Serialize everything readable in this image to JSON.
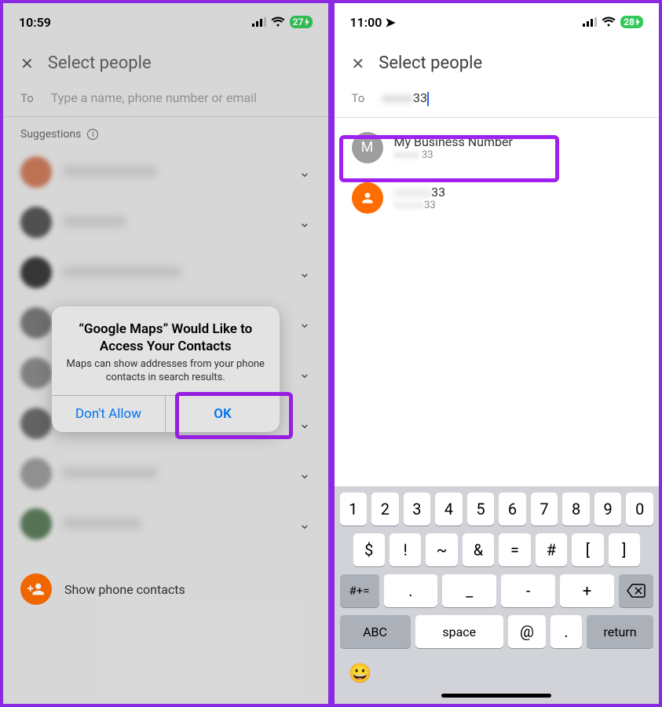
{
  "left": {
    "status": {
      "time": "10:59",
      "battery": "27"
    },
    "header": {
      "title": "Select people"
    },
    "to": {
      "label": "To",
      "placeholder": "Type a name, phone number or email"
    },
    "suggestions_label": "Suggestions",
    "dialog": {
      "title": "“Google Maps” Would Like to Access Your Contacts",
      "message": "Maps can show addresses from your phone contacts in search results.",
      "deny": "Don't Allow",
      "allow": "OK"
    },
    "show_contacts": "Show phone contacts"
  },
  "right": {
    "status": {
      "time": "11:00",
      "battery": "28"
    },
    "header": {
      "title": "Select people"
    },
    "to": {
      "label": "To",
      "value": "33"
    },
    "results": [
      {
        "name": "My Business Number",
        "sub": "33",
        "avatar_letter": "M"
      },
      {
        "name": "33",
        "sub": "33",
        "avatar_letter": ""
      }
    ],
    "keyboard": {
      "row1": [
        "1",
        "2",
        "3",
        "4",
        "5",
        "6",
        "7",
        "8",
        "9",
        "0"
      ],
      "row2": [
        "$",
        "!",
        "~",
        "&",
        "=",
        "#",
        "[",
        "]"
      ],
      "row3_sym": "#+=",
      "row3": [
        ".",
        ",",
        "?",
        "!",
        "'"
      ],
      "row3_alt": [
        ".",
        "_",
        "-",
        "+"
      ],
      "abc": "ABC",
      "space": "space",
      "at": "@",
      "dot": ".",
      "return": "return"
    }
  }
}
